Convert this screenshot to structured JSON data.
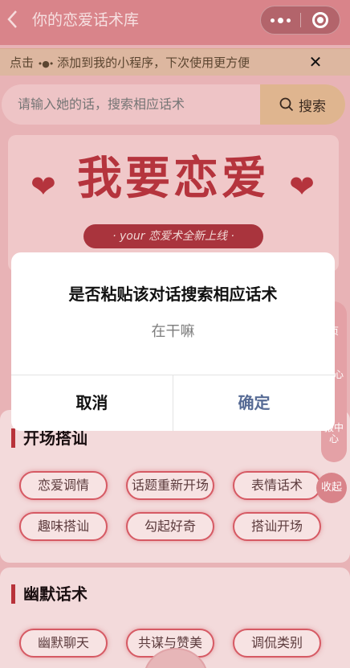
{
  "nav": {
    "back_icon": "chevron-left-icon",
    "title": "你的恋爱话术库"
  },
  "tip": {
    "prefix": "点击",
    "dots": "•●•",
    "text": "添加到我的小程序，下次使用更方便",
    "close": "✕"
  },
  "search": {
    "placeholder": "请输入她的话，搜索相应话术",
    "button_label": "搜索"
  },
  "banner": {
    "title": "我要恋爱",
    "subtitle": "· your 恋爱术全新上线 ·"
  },
  "side": {
    "items": [
      "页",
      "动心",
      "报中心"
    ],
    "fold_label": "收起"
  },
  "sections": [
    {
      "title": "开场搭讪",
      "tags": [
        "恋爱调情",
        "话题重新开场",
        "表情话术",
        "趣味搭讪",
        "勾起好奇",
        "搭讪开场"
      ]
    },
    {
      "title": "幽默话术",
      "tags": [
        "幽默聊天",
        "共谋与赞美",
        "调侃类别"
      ]
    }
  ],
  "dialog": {
    "title": "是否粘贴该对话搜索相应话术",
    "content": "在干嘛",
    "cancel_label": "取消",
    "confirm_label": "确定"
  },
  "colors": {
    "accent": "#b5343d",
    "confirm": "#576b95"
  }
}
